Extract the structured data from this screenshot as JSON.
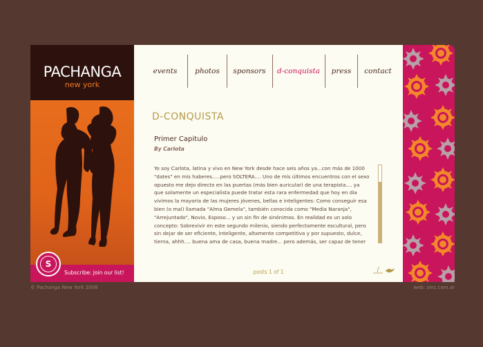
{
  "brand": {
    "name": "PACHANGA",
    "city": "new york"
  },
  "nav": [
    {
      "label": "events",
      "active": false
    },
    {
      "label": "photos",
      "active": false
    },
    {
      "label": "sponsors",
      "active": false
    },
    {
      "label": "d-conquista",
      "active": true
    },
    {
      "label": "press",
      "active": false
    },
    {
      "label": "contact",
      "active": false
    }
  ],
  "section": {
    "title": "D-CONQUISTA"
  },
  "article": {
    "title": "Primer Capitulo",
    "author": "By Carlota",
    "body": "Yo soy Carlota, latina y vivo en New York desde hace seis años ya...con más de 1000 \"dates\" en mis haberes.....pero SOLTERA.... Uno de mis últimos encuentros con el sexo opuesto me dejo directo en las puertas (más bien auricular) de una terapista.... ya que solamente un especialista puede tratar esta rara enfermedad que hoy en dia vivimos la mayoria de las mujeres jóvenes, bellas e inteligentes: Como conseguir esa bien (o mal) llamada \"Alma Gemela\", también conocida como \"Media Naranja\", \"Arrejuntado\", Novio, Esposo... y un sin fin de sinónimos. En realidad es un solo concepto: Sobrevivir en este segundo milenio, siendo perfectamente escultural, pero sin dejar de ser eficiente, inteligente, altamente competitiva y por supuesto, dulce, tierna, ahhh.... buena ama de casa, buena madre... pero además, ser capaz de tener buen sexo.....Dios!!! En que momento se nos impusieron todas estas \"tareas\" ¿?? O más bien, cualidades"
  },
  "pagination": {
    "label": "posts 1 of 1"
  },
  "subscribe": {
    "label": "Subscribe: Join our list!",
    "icon_letter": "S"
  },
  "footer": {
    "copyright": "© Pachanga New York 2008",
    "credit": "web: zinc.com.ar"
  },
  "colors": {
    "background": "#553930",
    "accent": "#c8155b",
    "orange": "#e86d1c",
    "gold": "#b49a4a"
  }
}
